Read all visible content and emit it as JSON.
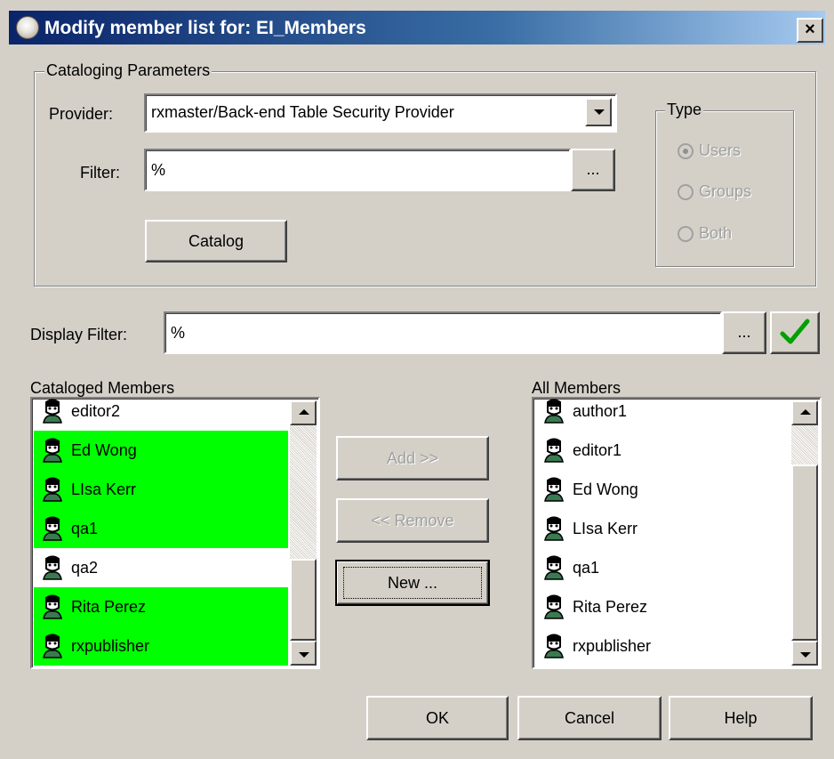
{
  "window": {
    "title": "Modify member list for: EI_Members",
    "close_label": "×"
  },
  "cataloging": {
    "legend": "Cataloging Parameters",
    "provider_label": "Provider:",
    "provider_value": "rxmaster/Back-end Table Security Provider",
    "filter_label": "Filter:",
    "filter_value": "%",
    "filter_browse_label": "...",
    "catalog_button": "Catalog",
    "type": {
      "legend": "Type",
      "options": [
        {
          "label": "Users",
          "selected": true
        },
        {
          "label": "Groups",
          "selected": false
        },
        {
          "label": "Both",
          "selected": false
        }
      ]
    }
  },
  "display_filter": {
    "label": "Display Filter:",
    "value": "%",
    "browse_label": "...",
    "apply_icon": "checkmark-icon",
    "apply_color": "#00a000"
  },
  "cataloged_members": {
    "label": "Cataloged Members",
    "highlight_color": "#00ff00",
    "items": [
      {
        "name": "editor2",
        "highlighted": false
      },
      {
        "name": "Ed Wong",
        "highlighted": true
      },
      {
        "name": "LIsa Kerr",
        "highlighted": true
      },
      {
        "name": "qa1",
        "highlighted": true
      },
      {
        "name": "qa2",
        "highlighted": false
      },
      {
        "name": "Rita Perez",
        "highlighted": true
      },
      {
        "name": "rxpublisher",
        "highlighted": true
      }
    ]
  },
  "all_members": {
    "label": "All Members",
    "items": [
      {
        "name": "author1"
      },
      {
        "name": "editor1"
      },
      {
        "name": "Ed Wong"
      },
      {
        "name": "LIsa Kerr"
      },
      {
        "name": "qa1"
      },
      {
        "name": "Rita Perez"
      },
      {
        "name": "rxpublisher"
      }
    ]
  },
  "actions": {
    "add_label": "Add >>",
    "remove_label": "<< Remove",
    "new_label": "New ..."
  },
  "footer": {
    "ok_label": "OK",
    "cancel_label": "Cancel",
    "help_label": "Help"
  }
}
